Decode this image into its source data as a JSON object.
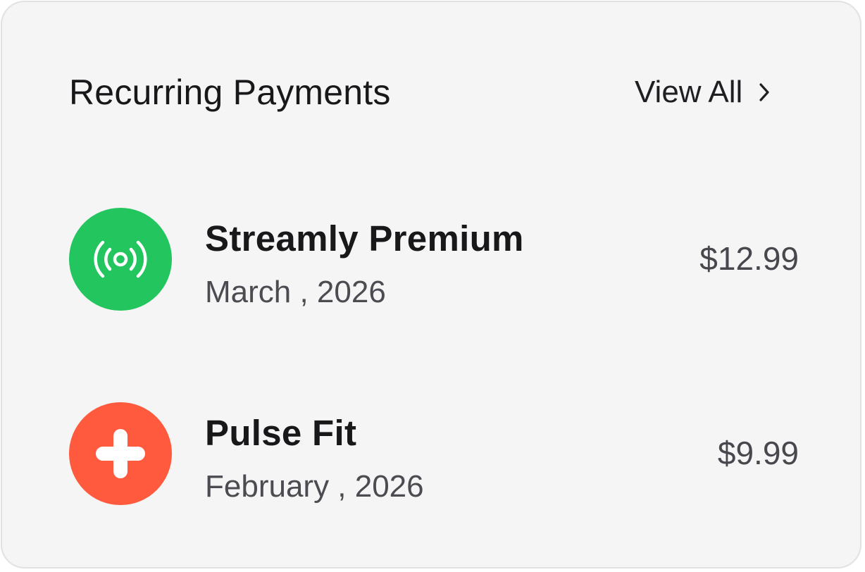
{
  "header": {
    "title": "Recurring Payments",
    "view_all_label": "View All",
    "view_all_icon": "chevron-right-icon"
  },
  "payments": [
    {
      "name": "Streamly Premium",
      "date": "March , 2026",
      "amount": "$12.99",
      "icon": "broadcast-icon",
      "color": "#22c55e"
    },
    {
      "name": "Pulse Fit",
      "date": "February , 2026",
      "amount": "$9.99",
      "icon": "plus-icon",
      "color": "#ff5a3d"
    }
  ]
}
